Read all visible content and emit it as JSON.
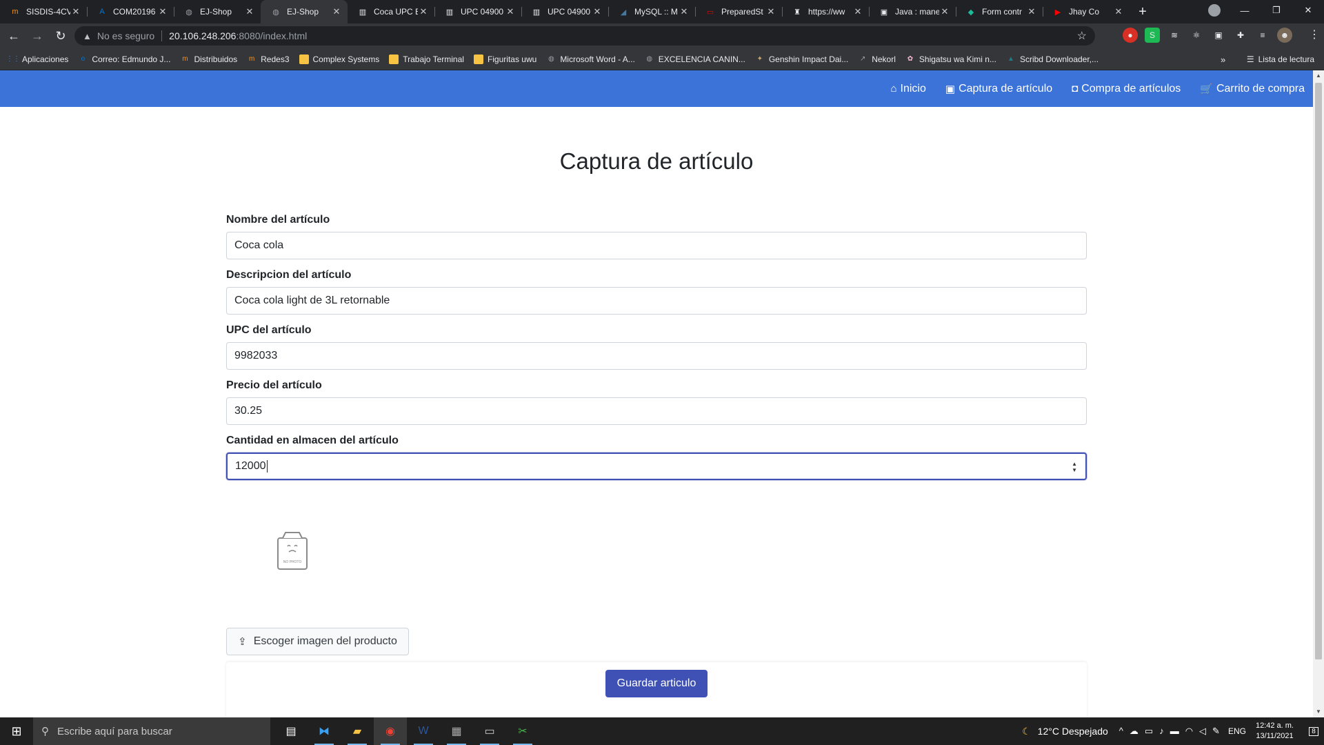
{
  "browser": {
    "tabs": [
      {
        "title": "SISDIS-4CV",
        "icon": "moodle-icon",
        "color": "#f7941d",
        "glyph": "m",
        "active": false
      },
      {
        "title": "COM20196",
        "icon": "azure-icon",
        "color": "#0078d4",
        "glyph": "A",
        "active": false
      },
      {
        "title": "EJ-Shop",
        "icon": "globe-icon",
        "color": "#9aa0a6",
        "glyph": "◍",
        "active": false
      },
      {
        "title": "EJ-Shop",
        "icon": "globe-icon",
        "color": "#9aa0a6",
        "glyph": "◍",
        "active": true
      },
      {
        "title": "Coca UPC E",
        "icon": "barcode-icon",
        "color": "#e8eaed",
        "glyph": "▥",
        "active": false
      },
      {
        "title": "UPC 04900",
        "icon": "barcode-icon",
        "color": "#e8eaed",
        "glyph": "▥",
        "active": false
      },
      {
        "title": "UPC 04900",
        "icon": "barcode-icon",
        "color": "#e8eaed",
        "glyph": "▥",
        "active": false
      },
      {
        "title": "MySQL :: M",
        "icon": "mysql-icon",
        "color": "#4479a1",
        "glyph": "◢",
        "active": false
      },
      {
        "title": "PreparedSt",
        "icon": "oracle-icon",
        "color": "#e00",
        "glyph": "▭",
        "active": false
      },
      {
        "title": "https://ww",
        "icon": "shield-crest-icon",
        "color": "#e8eaed",
        "glyph": "♜",
        "active": false
      },
      {
        "title": "Java : mane",
        "icon": "stackexchange-icon",
        "color": "#e8eaed",
        "glyph": "▣",
        "active": false
      },
      {
        "title": "Form contr",
        "icon": "leaf-icon",
        "color": "#1abc9c",
        "glyph": "◆",
        "active": false
      },
      {
        "title": "Jhay Co",
        "icon": "youtube-icon",
        "color": "#ff0000",
        "glyph": "▶",
        "active": false
      }
    ],
    "address": {
      "security_label": "No es seguro",
      "host": "20.106.248.206",
      "path": ":8080/index.html"
    },
    "bookmarks": [
      {
        "label": "Aplicaciones",
        "icon": "apps-grid-icon",
        "color": "#4285f4",
        "glyph": "⋮⋮"
      },
      {
        "label": "Correo: Edmundo J...",
        "icon": "outlook-icon",
        "color": "#0078d4",
        "glyph": "o"
      },
      {
        "label": "Distribuidos",
        "icon": "moodle-icon",
        "color": "#f7941d",
        "glyph": "m"
      },
      {
        "label": "Redes3",
        "icon": "moodle-icon",
        "color": "#f7941d",
        "glyph": "m"
      },
      {
        "label": "Complex Systems",
        "icon": "folder-icon",
        "color": "#f6c343",
        "glyph": ""
      },
      {
        "label": "Trabajo Terminal",
        "icon": "folder-icon",
        "color": "#f6c343",
        "glyph": ""
      },
      {
        "label": "Figuritas uwu",
        "icon": "folder-icon",
        "color": "#f6c343",
        "glyph": ""
      },
      {
        "label": "Microsoft Word - A...",
        "icon": "globe-icon",
        "color": "#9aa0a6",
        "glyph": "◍"
      },
      {
        "label": "EXCELENCIA CANIN...",
        "icon": "globe-icon",
        "color": "#9aa0a6",
        "glyph": "◍"
      },
      {
        "label": "Genshin Impact Dai...",
        "icon": "genshin-icon",
        "color": "#c9a86b",
        "glyph": "✦"
      },
      {
        "label": "Nekorl",
        "icon": "bookmark-page-icon",
        "color": "#9aa0a6",
        "glyph": "↗"
      },
      {
        "label": "Shigatsu wa Kimi n...",
        "icon": "sakura-icon",
        "color": "#f8bbd0",
        "glyph": "✿"
      },
      {
        "label": "Scribd Downloader,...",
        "icon": "scribd-icon",
        "color": "#1e7b85",
        "glyph": "▲"
      }
    ],
    "reading_list": "Lista de lectura"
  },
  "nav": {
    "items": [
      {
        "label": "Inicio",
        "icon": "home-icon",
        "glyph": "⌂"
      },
      {
        "label": "Captura de artículo",
        "icon": "save-icon",
        "glyph": "▣"
      },
      {
        "label": "Compra de artículos",
        "icon": "shopping-bag-icon",
        "glyph": "◘"
      },
      {
        "label": "Carrito de compra",
        "icon": "cart-icon",
        "glyph": "🛒"
      }
    ],
    "color": "#3b73d9"
  },
  "page": {
    "title": "Captura de artículo",
    "fields": [
      {
        "label": "Nombre del artículo",
        "value": "Coca cola"
      },
      {
        "label": "Descripcion del artículo",
        "value": "Coca cola light de 3L retornable"
      },
      {
        "label": "UPC del artículo",
        "value": "9982033"
      },
      {
        "label": "Precio del artículo",
        "value": "30.25"
      },
      {
        "label": "Cantidad en almacen del artículo",
        "value": "12000"
      }
    ],
    "photo_placeholder": "NO PHOTO",
    "upload_label": "Escoger imagen del producto",
    "save_label": "Guardar articulo",
    "accent": "#3f51b5"
  },
  "taskbar": {
    "search_placeholder": "Escribe aquí para buscar",
    "weather": "12°C  Despejado",
    "language": "ENG",
    "time": "12:42 a. m.",
    "date": "13/11/2021",
    "notifications": "8"
  }
}
